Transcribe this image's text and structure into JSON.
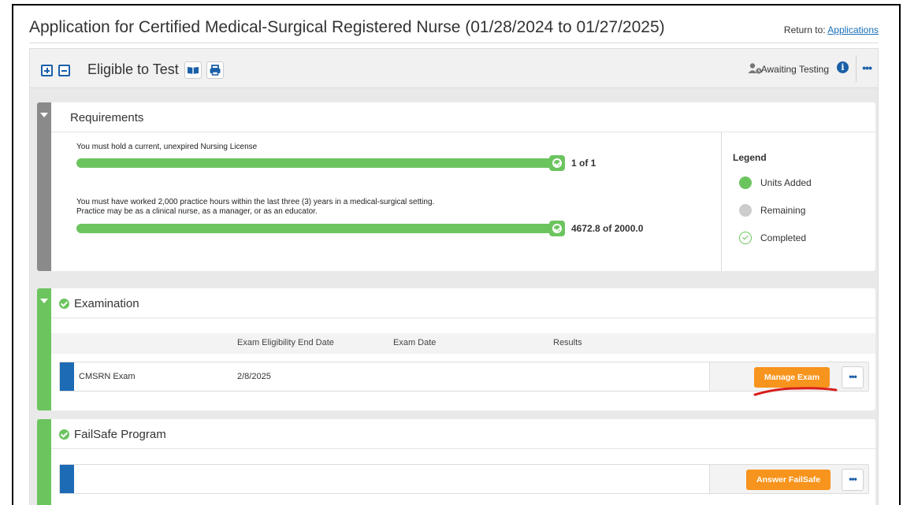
{
  "page": {
    "title": "Application for Certified Medical-Surgical Registered Nurse (01/28/2024 to 01/27/2025)",
    "return_prefix": "Return to:",
    "return_link": "Applications"
  },
  "status_bar": {
    "title": "Eligible to Test",
    "status_label": "Awaiting Testing",
    "icons": [
      "plus-square-icon",
      "minus-square-icon",
      "book-icon",
      "print-icon",
      "user-clock-icon",
      "info-icon",
      "ellipsis-icon"
    ]
  },
  "requirements": {
    "title": "Requirements",
    "items": [
      {
        "text_lines": [
          "You must hold a current, unexpired Nursing License"
        ],
        "progress_label": "1 of 1",
        "progress": 1.0
      },
      {
        "text_lines": [
          "You must have worked 2,000 practice hours within the last three (3) years in a medical-surgical setting.",
          "Practice may be as a clinical nurse, as a manager, or as an educator."
        ],
        "progress_label": "4672.8 of 2000.0",
        "progress": 1.0
      }
    ],
    "legend": {
      "title": "Legend",
      "items": [
        "Units Added",
        "Remaining",
        "Completed"
      ]
    }
  },
  "examination": {
    "title": "Examination",
    "columns": [
      "Exam Eligibility End Date",
      "Exam Date",
      "Results"
    ],
    "rows": [
      {
        "name": "CMSRN Exam",
        "eligibility_end": "2/8/2025",
        "exam_date": "",
        "results": "",
        "action_label": "Manage Exam"
      }
    ]
  },
  "failsafe": {
    "title": "FailSafe Program",
    "action_label": "Answer FailSafe"
  },
  "colors": {
    "accent_blue": "#1a5fa8",
    "green": "#6cc45f",
    "orange": "#f7941d",
    "annotation_red": "#d81e1e"
  }
}
